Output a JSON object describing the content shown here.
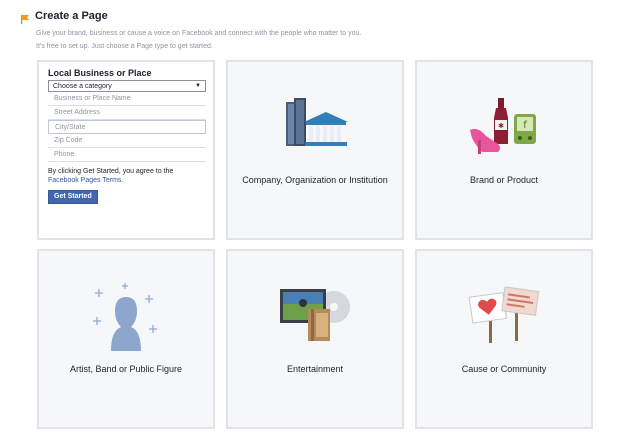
{
  "header": {
    "title": "Create a Page",
    "subtitle_line1": "Give your brand, business or cause a voice on Facebook and connect with the people who matter to you.",
    "subtitle_line2": "It's free to set up. Just choose a Page type to get started."
  },
  "form": {
    "title": "Local Business or Place",
    "category_selected": "Choose a category",
    "fields": {
      "business_name": "Business or Place Name",
      "street": "Street Address",
      "city": "City/State",
      "zip": "Zip Code",
      "phone": "Phone"
    },
    "terms_prefix": "By clicking Get Started, you agree to the",
    "terms_link": "Facebook Pages Terms.",
    "submit_label": "Get Started"
  },
  "tiles": [
    {
      "label": "Company, Organization or Institution",
      "icon": "buildings-icon"
    },
    {
      "label": "Brand or Product",
      "icon": "products-icon"
    },
    {
      "label": "Artist, Band or Public Figure",
      "icon": "person-sparkle-icon"
    },
    {
      "label": "Entertainment",
      "icon": "media-icon"
    },
    {
      "label": "Cause or Community",
      "icon": "signs-icon"
    }
  ],
  "colors": {
    "accent": "#4267b2",
    "link": "#365899",
    "tile_bg": "#f6f7f9",
    "tile_border": "#e1e3e8"
  }
}
